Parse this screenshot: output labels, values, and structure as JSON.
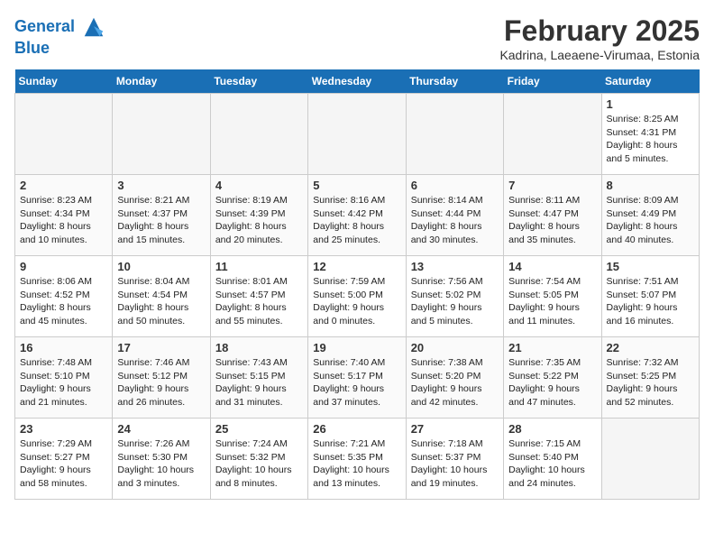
{
  "header": {
    "logo_line1": "General",
    "logo_line2": "Blue",
    "month": "February 2025",
    "location": "Kadrina, Laeaene-Virumaa, Estonia"
  },
  "weekdays": [
    "Sunday",
    "Monday",
    "Tuesday",
    "Wednesday",
    "Thursday",
    "Friday",
    "Saturday"
  ],
  "weeks": [
    [
      {
        "day": "",
        "info": ""
      },
      {
        "day": "",
        "info": ""
      },
      {
        "day": "",
        "info": ""
      },
      {
        "day": "",
        "info": ""
      },
      {
        "day": "",
        "info": ""
      },
      {
        "day": "",
        "info": ""
      },
      {
        "day": "1",
        "info": "Sunrise: 8:25 AM\nSunset: 4:31 PM\nDaylight: 8 hours and 5 minutes."
      }
    ],
    [
      {
        "day": "2",
        "info": "Sunrise: 8:23 AM\nSunset: 4:34 PM\nDaylight: 8 hours and 10 minutes."
      },
      {
        "day": "3",
        "info": "Sunrise: 8:21 AM\nSunset: 4:37 PM\nDaylight: 8 hours and 15 minutes."
      },
      {
        "day": "4",
        "info": "Sunrise: 8:19 AM\nSunset: 4:39 PM\nDaylight: 8 hours and 20 minutes."
      },
      {
        "day": "5",
        "info": "Sunrise: 8:16 AM\nSunset: 4:42 PM\nDaylight: 8 hours and 25 minutes."
      },
      {
        "day": "6",
        "info": "Sunrise: 8:14 AM\nSunset: 4:44 PM\nDaylight: 8 hours and 30 minutes."
      },
      {
        "day": "7",
        "info": "Sunrise: 8:11 AM\nSunset: 4:47 PM\nDaylight: 8 hours and 35 minutes."
      },
      {
        "day": "8",
        "info": "Sunrise: 8:09 AM\nSunset: 4:49 PM\nDaylight: 8 hours and 40 minutes."
      }
    ],
    [
      {
        "day": "9",
        "info": "Sunrise: 8:06 AM\nSunset: 4:52 PM\nDaylight: 8 hours and 45 minutes."
      },
      {
        "day": "10",
        "info": "Sunrise: 8:04 AM\nSunset: 4:54 PM\nDaylight: 8 hours and 50 minutes."
      },
      {
        "day": "11",
        "info": "Sunrise: 8:01 AM\nSunset: 4:57 PM\nDaylight: 8 hours and 55 minutes."
      },
      {
        "day": "12",
        "info": "Sunrise: 7:59 AM\nSunset: 5:00 PM\nDaylight: 9 hours and 0 minutes."
      },
      {
        "day": "13",
        "info": "Sunrise: 7:56 AM\nSunset: 5:02 PM\nDaylight: 9 hours and 5 minutes."
      },
      {
        "day": "14",
        "info": "Sunrise: 7:54 AM\nSunset: 5:05 PM\nDaylight: 9 hours and 11 minutes."
      },
      {
        "day": "15",
        "info": "Sunrise: 7:51 AM\nSunset: 5:07 PM\nDaylight: 9 hours and 16 minutes."
      }
    ],
    [
      {
        "day": "16",
        "info": "Sunrise: 7:48 AM\nSunset: 5:10 PM\nDaylight: 9 hours and 21 minutes."
      },
      {
        "day": "17",
        "info": "Sunrise: 7:46 AM\nSunset: 5:12 PM\nDaylight: 9 hours and 26 minutes."
      },
      {
        "day": "18",
        "info": "Sunrise: 7:43 AM\nSunset: 5:15 PM\nDaylight: 9 hours and 31 minutes."
      },
      {
        "day": "19",
        "info": "Sunrise: 7:40 AM\nSunset: 5:17 PM\nDaylight: 9 hours and 37 minutes."
      },
      {
        "day": "20",
        "info": "Sunrise: 7:38 AM\nSunset: 5:20 PM\nDaylight: 9 hours and 42 minutes."
      },
      {
        "day": "21",
        "info": "Sunrise: 7:35 AM\nSunset: 5:22 PM\nDaylight: 9 hours and 47 minutes."
      },
      {
        "day": "22",
        "info": "Sunrise: 7:32 AM\nSunset: 5:25 PM\nDaylight: 9 hours and 52 minutes."
      }
    ],
    [
      {
        "day": "23",
        "info": "Sunrise: 7:29 AM\nSunset: 5:27 PM\nDaylight: 9 hours and 58 minutes."
      },
      {
        "day": "24",
        "info": "Sunrise: 7:26 AM\nSunset: 5:30 PM\nDaylight: 10 hours and 3 minutes."
      },
      {
        "day": "25",
        "info": "Sunrise: 7:24 AM\nSunset: 5:32 PM\nDaylight: 10 hours and 8 minutes."
      },
      {
        "day": "26",
        "info": "Sunrise: 7:21 AM\nSunset: 5:35 PM\nDaylight: 10 hours and 13 minutes."
      },
      {
        "day": "27",
        "info": "Sunrise: 7:18 AM\nSunset: 5:37 PM\nDaylight: 10 hours and 19 minutes."
      },
      {
        "day": "28",
        "info": "Sunrise: 7:15 AM\nSunset: 5:40 PM\nDaylight: 10 hours and 24 minutes."
      },
      {
        "day": "",
        "info": ""
      }
    ]
  ]
}
